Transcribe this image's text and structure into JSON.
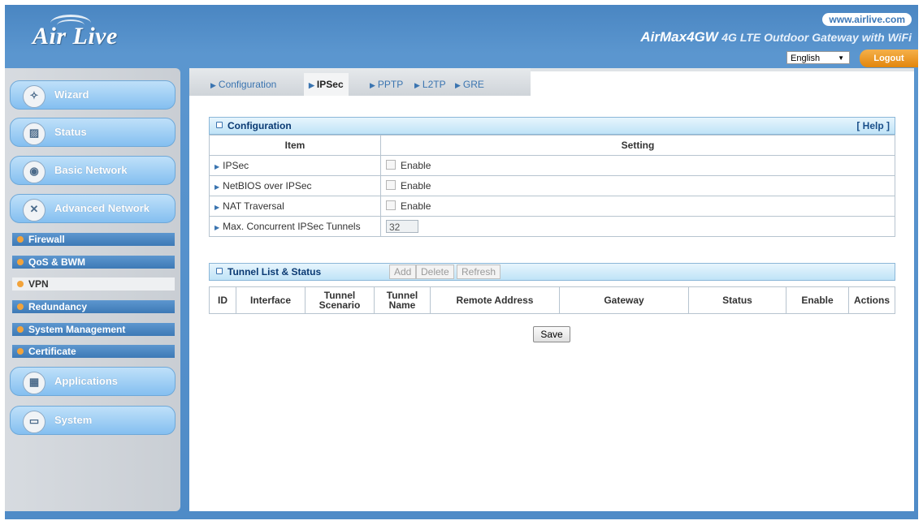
{
  "header": {
    "logo_text": "Air Live",
    "site_url": "www.airlive.com",
    "model": "AirMax4GW",
    "description": "4G LTE Outdoor Gateway with WiFi",
    "language": "English",
    "logout": "Logout"
  },
  "sidebar": {
    "main_items": [
      {
        "label": "Wizard",
        "icon": "wand-icon"
      },
      {
        "label": "Status",
        "icon": "chart-icon"
      },
      {
        "label": "Basic Network",
        "icon": "globe-icon"
      },
      {
        "label": "Advanced Network",
        "icon": "tools-icon"
      }
    ],
    "sub_items": [
      {
        "label": "Firewall"
      },
      {
        "label": "QoS & BWM"
      },
      {
        "label": "VPN",
        "active": true
      },
      {
        "label": "Redundancy"
      },
      {
        "label": "System Management"
      },
      {
        "label": "Certificate"
      }
    ],
    "lower_items": [
      {
        "label": "Applications",
        "icon": "apps-icon"
      },
      {
        "label": "System",
        "icon": "monitor-icon"
      }
    ]
  },
  "tabs": [
    {
      "label": "Configuration"
    },
    {
      "label": "IPSec",
      "active": true
    },
    {
      "label": "PPTP"
    },
    {
      "label": "L2TP"
    },
    {
      "label": "GRE"
    }
  ],
  "configuration": {
    "title": "Configuration",
    "help": "[ Help ]",
    "col_item": "Item",
    "col_setting": "Setting",
    "rows": [
      {
        "label": "IPSec",
        "setting": "Enable"
      },
      {
        "label": "NetBIOS over IPSec",
        "setting": "Enable"
      },
      {
        "label": "NAT Traversal",
        "setting": "Enable"
      },
      {
        "label": "Max. Concurrent IPSec Tunnels",
        "value": "32"
      }
    ]
  },
  "tunnel_list": {
    "title": "Tunnel List & Status",
    "buttons": {
      "add": "Add",
      "delete": "Delete",
      "refresh": "Refresh"
    },
    "columns": [
      "ID",
      "Interface",
      "Tunnel Scenario",
      "Tunnel Name",
      "Remote Address",
      "Gateway",
      "Status",
      "Enable",
      "Actions"
    ]
  },
  "save_label": "Save"
}
